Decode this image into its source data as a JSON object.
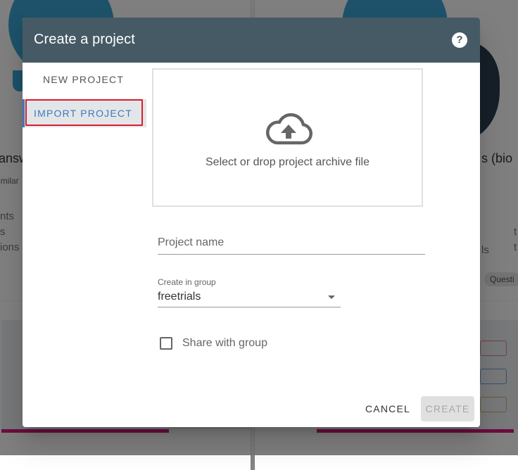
{
  "background": {
    "left_card_title": "answ",
    "left_card_sub": "imilar",
    "left_card_lines": [
      "nts",
      "s",
      "ions"
    ],
    "right_card_title": "s (bio",
    "right_card_line": "ls",
    "right_card_chip": "Questi",
    "right_card_side": [
      "t",
      "t"
    ]
  },
  "dialog": {
    "title": "Create a project",
    "help_icon": "question-circle-icon",
    "nav": {
      "new_project": "NEW PROJECT",
      "import_project": "IMPORT PROJECT",
      "active": "import_project"
    },
    "dropzone": {
      "icon": "cloud-upload-icon",
      "text": "Select or drop project archive file"
    },
    "project_name": {
      "placeholder": "Project name",
      "value": ""
    },
    "group": {
      "label": "Create in group",
      "value": "freetrials"
    },
    "share": {
      "label": "Share with group",
      "checked": false
    },
    "actions": {
      "cancel": "CANCEL",
      "create": "CREATE",
      "create_disabled": true
    }
  },
  "colors": {
    "header": "#465a65",
    "accent": "#3d79b8",
    "focus_ring": "#d91e2b"
  }
}
